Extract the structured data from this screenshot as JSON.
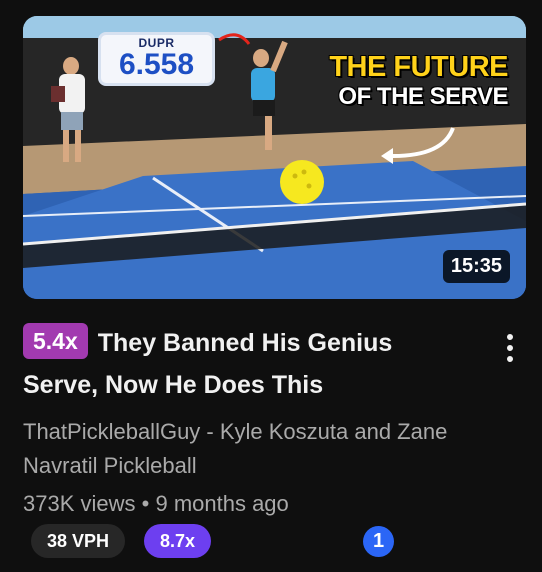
{
  "thumbnail": {
    "dupr_label": "DUPR",
    "dupr_value": "6.558",
    "headline_line1": "THE FUTURE",
    "headline_line2": "OF THE SERVE",
    "duration": "15:35"
  },
  "video": {
    "outlier_score": "5.4x",
    "title": "They Banned His Genius Serve, Now He Does This",
    "channel": "ThatPickleballGuy - Kyle Koszuta and Zane Navratil Pickleball",
    "views": "373K views",
    "separator": "•",
    "age": "9 months ago"
  },
  "metrics": {
    "vph": "38 VPH",
    "multiplier": "8.7x",
    "info_glyph": "1"
  },
  "colors": {
    "outlier_badge": "#a23ab0",
    "multiplier_pill": "#6d3ff0",
    "vph_pill": "#272727",
    "info_icon": "#2b66f6",
    "headline_yellow": "#ffd21a"
  },
  "icons": {
    "menu": "more-vert-icon",
    "info": "info-circle-icon"
  }
}
